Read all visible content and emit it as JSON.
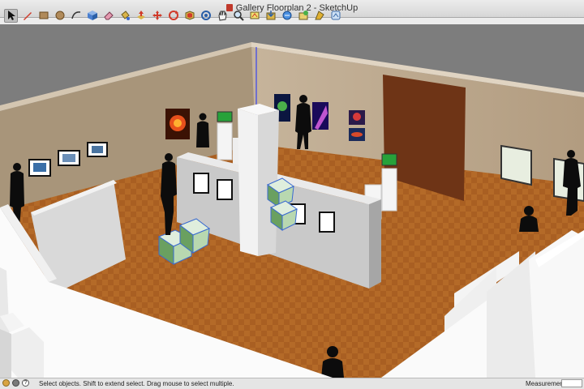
{
  "window": {
    "title": "Gallery Floorplan 2 - SketchUp"
  },
  "toolbar": {
    "tools": [
      {
        "name": "select-tool-icon",
        "active": true
      },
      {
        "name": "pencil-line-tool-icon"
      },
      {
        "name": "rectangle-tool-icon"
      },
      {
        "name": "circle-tool-icon"
      },
      {
        "name": "arc-tool-icon"
      },
      {
        "name": "make-component-icon"
      },
      {
        "name": "eraser-tool-icon"
      },
      {
        "name": "paint-bucket-tool-icon"
      },
      {
        "name": "push-pull-tool-icon"
      },
      {
        "name": "move-tool-icon"
      },
      {
        "name": "rotate-tool-icon"
      },
      {
        "name": "offset-tool-icon"
      },
      {
        "name": "orbit-tool-icon"
      },
      {
        "name": "pan-tool-icon"
      },
      {
        "name": "zoom-tool-icon"
      },
      {
        "name": "zoom-extents-icon"
      },
      {
        "name": "get-models-icon"
      },
      {
        "name": "share-model-icon"
      },
      {
        "name": "share-component-icon"
      },
      {
        "name": "extension-warehouse-icon"
      },
      {
        "name": "layout-icon"
      }
    ]
  },
  "statusbar": {
    "icons": [
      "geo-location-icon",
      "credits-icon",
      "help-icon"
    ],
    "message": "Select objects. Shift to extend select. Drag mouse to select multiple.",
    "measurements_label": "Measurements",
    "measurements_value": ""
  }
}
